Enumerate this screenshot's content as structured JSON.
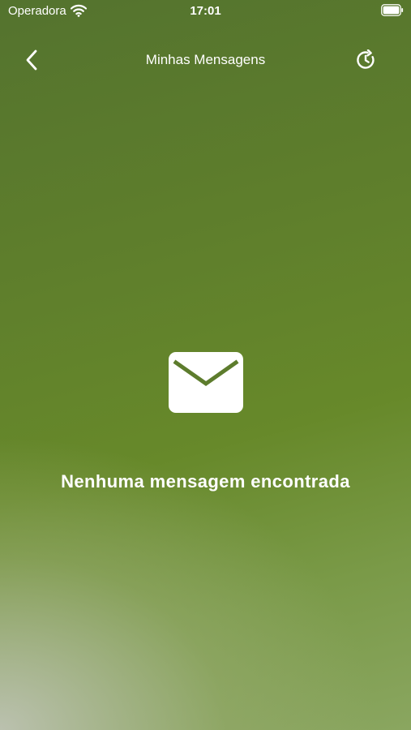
{
  "status_bar": {
    "carrier": "Operadora",
    "time": "17:01",
    "icons": [
      "wifi-icon",
      "battery-icon"
    ]
  },
  "nav": {
    "title": "Minhas Mensagens",
    "back_icon": "chevron-left-icon",
    "history_icon": "history-icon"
  },
  "empty_state": {
    "icon": "envelope-icon",
    "message": "Nenhuma mensagem encontrada"
  },
  "colors": {
    "text": "#ffffff",
    "background_top": "#54732e",
    "background_mid": "#67892a",
    "background_bottom_left": "#bec3b4"
  }
}
